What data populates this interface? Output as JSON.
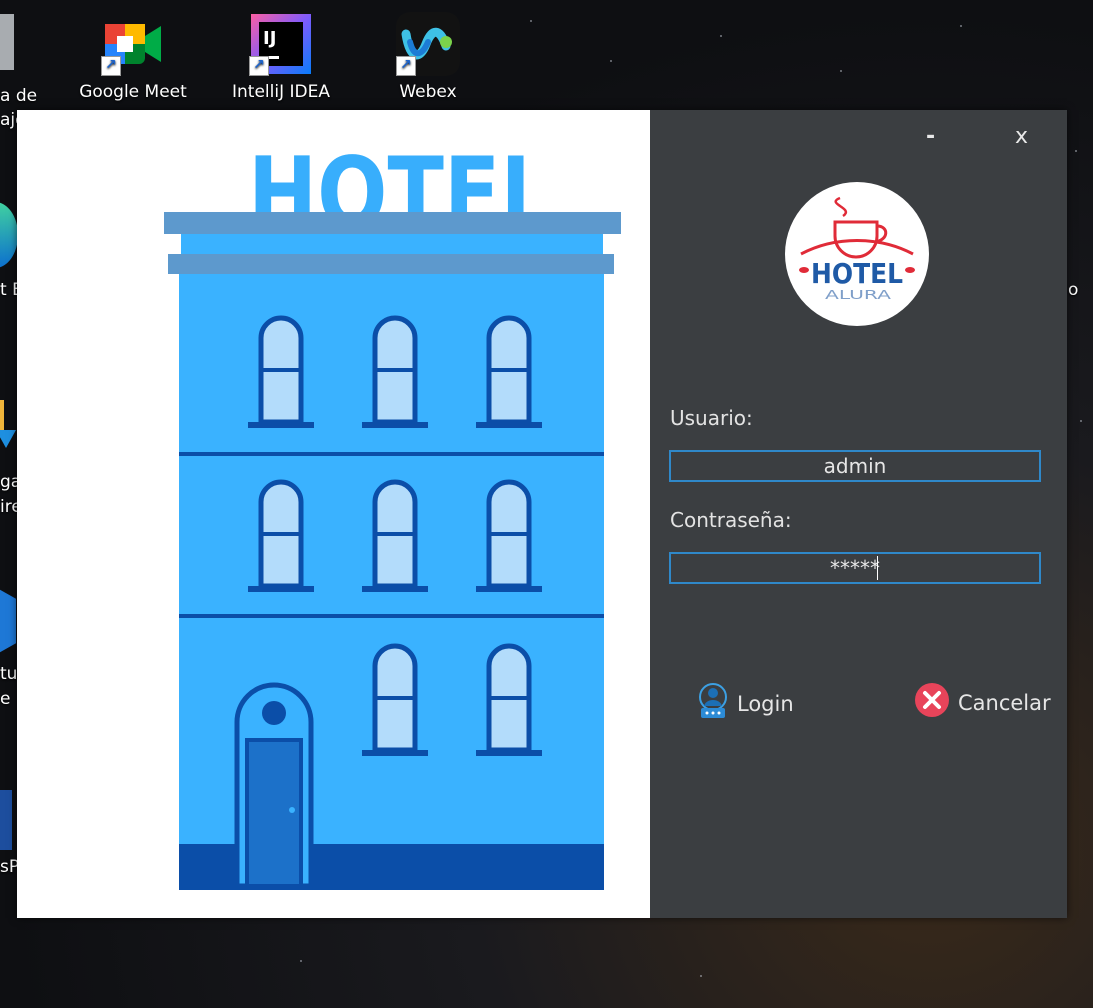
{
  "desktop": {
    "icons": [
      {
        "label": "Google Meet",
        "icon": "google-meet-icon"
      },
      {
        "label": "IntelliJ IDEA",
        "icon": "intellij-icon"
      },
      {
        "label": "Webex",
        "icon": "webex-icon"
      }
    ],
    "intellij_badge": "IJ",
    "partial_labels": {
      "recycle": "a de",
      "recycle2": "aje",
      "edge": "t E",
      "downloads": "gas",
      "downloads2": "ire",
      "studio": "tuc",
      "studio2": "e",
      "other": "sP",
      "right": "o"
    }
  },
  "window": {
    "minimize_label": "-",
    "close_label": "x",
    "hero_text": "HOTEL",
    "logo": {
      "title": "HOTEL",
      "subtitle": "ALURA"
    },
    "form": {
      "user_label": "Usuario:",
      "user_value": "admin",
      "password_label": "Contraseña:",
      "password_value": "*****"
    },
    "actions": {
      "login": "Login",
      "cancel": "Cancelar"
    },
    "colors": {
      "panel_bg": "#3b3e41",
      "field_border": "#2f88c9",
      "building": "#3ab2ff",
      "building_dark": "#0b4ea8",
      "cancel": "#e8445a"
    }
  }
}
